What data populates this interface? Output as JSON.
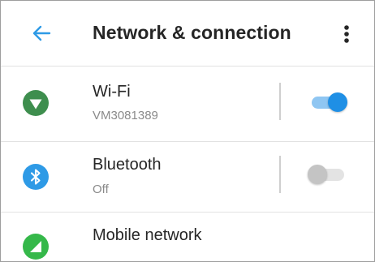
{
  "header": {
    "title": "Network & connection",
    "back_icon": "arrow-left-icon",
    "menu_icon": "more-vert-icon"
  },
  "settings": [
    {
      "id": "wifi",
      "title": "Wi-Fi",
      "subtitle": "VM3081389",
      "icon": "wifi-icon",
      "icon_color": "#3e8e4e",
      "toggle": "on"
    },
    {
      "id": "bluetooth",
      "title": "Bluetooth",
      "subtitle": "Off",
      "icon": "bluetooth-icon",
      "icon_color": "#2e9ae6",
      "toggle": "off"
    },
    {
      "id": "mobile",
      "title": "Mobile network",
      "icon": "signal-icon",
      "icon_color": "#35b84a"
    }
  ],
  "colors": {
    "accent": "#2e9ae6",
    "switch_on_track": "#8fc6f2",
    "switch_on_thumb": "#1f8fe5",
    "switch_off_track": "#e3e3e3",
    "switch_off_thumb": "#c4c4c4"
  }
}
